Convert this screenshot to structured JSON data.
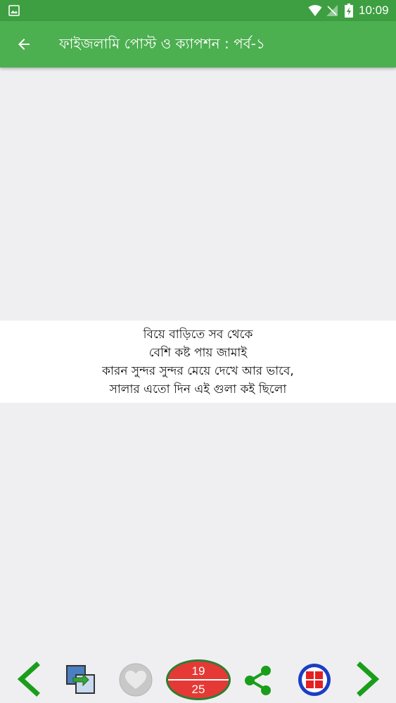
{
  "status_bar": {
    "time": "10:09",
    "icons": [
      "gallery-icon",
      "wifi-icon",
      "no-signal-icon",
      "battery-charging-icon"
    ]
  },
  "app_bar": {
    "title": "ফাইজলামি পোস্ট ও ক্যাপশন : পর্ব-১",
    "back_icon": "arrow-left-icon"
  },
  "post": {
    "lines": [
      "বিয়ে বাড়িতে সব থেকে",
      "বেশি কষ্ট পায় জামাই",
      "কারন সুন্দর সুন্দর মেয়ে দেখে আর ভাবে,",
      "সালার এতো দিন এই গুলা কই ছিলো"
    ]
  },
  "bottom_bar": {
    "counter_current": "19",
    "counter_total": "25",
    "buttons": [
      "chevron-left-icon",
      "copy-icon",
      "heart-icon",
      "share-icon",
      "grid-icon",
      "chevron-right-icon"
    ]
  },
  "colors": {
    "status_bar": "#3d9f41",
    "app_bar": "#4caf50",
    "background": "#efeff1",
    "accent_green": "#1a9e1a",
    "counter_red": "#e53935",
    "grid_blue": "#1a3fc4",
    "grid_red": "#e52020"
  }
}
